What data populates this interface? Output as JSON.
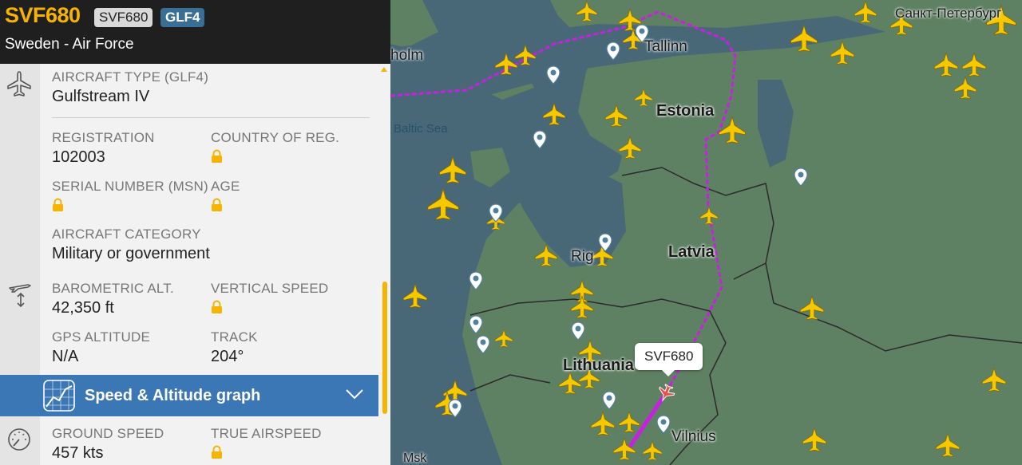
{
  "header": {
    "callsign": "SVF680",
    "callsign_badge": "SVF680",
    "type_badge": "GLF4",
    "operator": "Sweden - Air Force"
  },
  "details": {
    "aircraft_type_label": "AIRCRAFT TYPE (GLF4)",
    "aircraft_type_value": "Gulfstream IV",
    "registration_label": "REGISTRATION",
    "registration_value": "102003",
    "country_label": "COUNTRY OF REG.",
    "serial_label": "SERIAL NUMBER (MSN)",
    "age_label": "AGE",
    "category_label": "AIRCRAFT CATEGORY",
    "category_value": "Military or government",
    "baro_alt_label": "BAROMETRIC ALT.",
    "baro_alt_value": "42,350 ft",
    "vspeed_label": "VERTICAL SPEED",
    "gps_alt_label": "GPS ALTITUDE",
    "gps_alt_value": "N/A",
    "track_label": "TRACK",
    "track_value": "204°",
    "graph_label": "Speed & Altitude graph",
    "ground_speed_label": "GROUND SPEED",
    "ground_speed_value": "457 kts",
    "true_airspeed_label": "TRUE AIRSPEED"
  },
  "map": {
    "labels": {
      "tallinn": "Tallinn",
      "estonia": "Estonia",
      "latvia": "Latvia",
      "riga": "Rig",
      "lithuania": "Lithuania",
      "vilnius": "Vilnius",
      "baltic": "Baltic Sea",
      "holm": "holm",
      "spb": "Санкт-Петербург",
      "minsk": "Мsk"
    },
    "tooltip": "SVF680"
  },
  "colors": {
    "accent": "#f6b400",
    "route": "#c820e0",
    "graph_bar": "#3a77b4",
    "type_badge": "#3a6f95",
    "header_bg": "#1f1f1f"
  }
}
